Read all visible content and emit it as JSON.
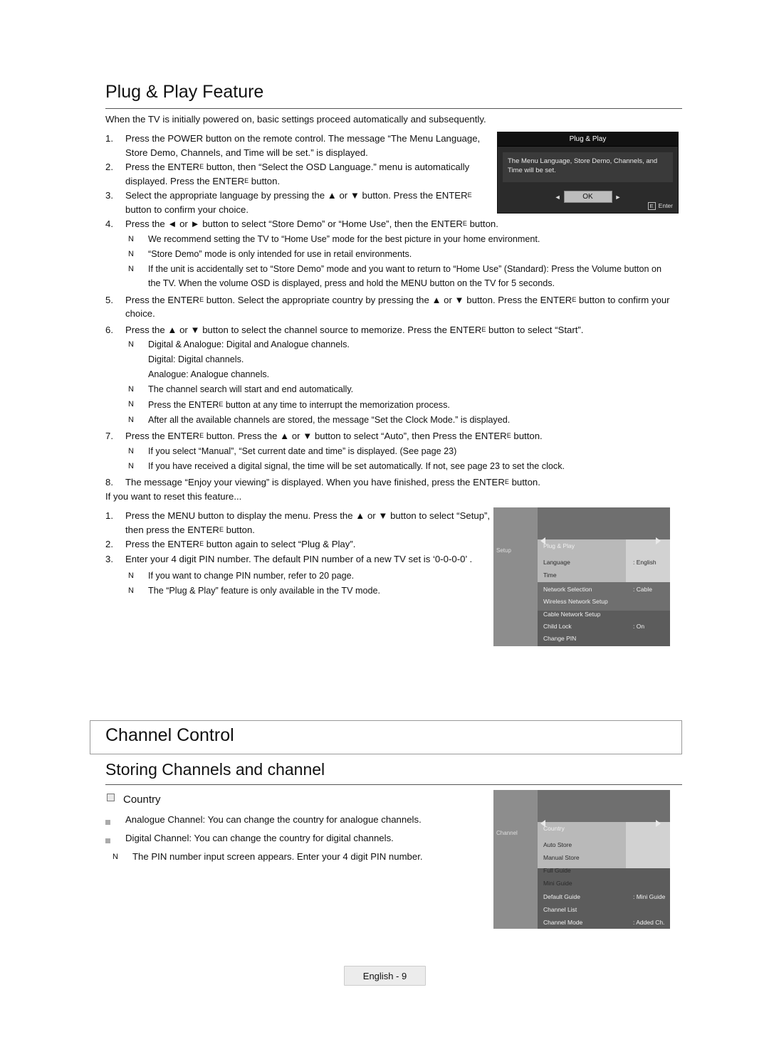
{
  "headings": {
    "plug_play": "Plug & Play Feature",
    "channel_control": "Channel Control",
    "storing": "Storing Channels and channel"
  },
  "intro": "When the TV is initially powered on, basic settings proceed automatically and subsequently.",
  "steps": [
    {
      "num": "1.",
      "text": "Press the POWER button on the remote control. The message “The Menu Language, Store Demo, Channels, and Time will be set.” is displayed.",
      "width": "narrow"
    },
    {
      "num": "2.",
      "text": "Press the ENTER",
      "tail": " button, then “Select the OSD Language.” menu is automatically displayed. Press the ENTER",
      "tail2": " button.",
      "width": "narrow",
      "enter": true
    },
    {
      "num": "3.",
      "text": "Select the appropriate language by pressing the ▲ or ▼ button. Press the ENTER",
      "tail": " button to confirm your choice.",
      "width": "narrow",
      "enter": true
    },
    {
      "num": "4.",
      "text": "Press the ◄ or ► button to select “Store Demo” or “Home Use”, then the ENTER",
      "tail": " button.",
      "width": "full",
      "enter": true
    }
  ],
  "notes_after_4": [
    "We recommend setting the TV to “Home Use” mode for the best picture in your home environment.",
    "“Store Demo” mode is only intended for use in retail environments.",
    "If the unit is accidentally set to “Store Demo” mode and you want to return to “Home Use” (Standard): Press the Volume button on the TV. When the volume OSD is displayed, press and hold the MENU button on the TV for 5 seconds."
  ],
  "step5": {
    "num": "5.",
    "a": "Press the ENTER",
    "b": " button. Select the appropriate country by pressing the ▲ or ▼ button. Press the ENTER",
    "c": " button to confirm your choice."
  },
  "step6": {
    "num": "6.",
    "a": "Press the ▲ or ▼ button to select the channel source to memorize. Press the ENTER",
    "b": " button to select “Start”."
  },
  "notes_after_6": [
    "Digital & Analogue: Digital and Analogue channels.",
    "Digital: Digital channels.",
    "Analogue: Analogue channels.",
    "The channel search will start and end automatically."
  ],
  "note_interrupt": {
    "a": "Press the ENTER",
    "b": " button at any time to interrupt the memorization process."
  },
  "note_stored": "After all the available channels are stored, the message “Set the Clock Mode.” is displayed.",
  "step7": {
    "num": "7.",
    "a": "Press the ENTER",
    "b": " button. Press the ▲ or ▼ button to select “Auto”, then Press the ENTER",
    "c": " button."
  },
  "notes_after_7": [
    "If you select “Manual”, “Set current date and time” is displayed. (See page 23)",
    "If you have received a digital signal, the time will be set automatically. If not, see page 23 to set the clock."
  ],
  "step8": {
    "num": "8.",
    "a": "The message “Enjoy your viewing” is displayed. When you have finished, press the ENTER",
    "b": " button."
  },
  "reset_lead": "If you want to reset this feature...",
  "reset_steps": [
    {
      "num": "1.",
      "text": "Press the MENU button to display the menu. Press the ▲ or ▼ button to select “Setup”, then press the ENTER",
      "tail": " button.",
      "enter": true
    },
    {
      "num": "2.",
      "text": "Press the ENTER",
      "tail": " button again to select “Plug & Play”.",
      "enter": true
    },
    {
      "num": "3.",
      "text": "Enter your 4 digit PIN number. The default PIN number of a new TV set is ‘0-0-0-0’ .",
      "enter": false
    }
  ],
  "reset_notes": [
    "If you want to change PIN number, refer to 20 page.",
    "The “Plug & Play” feature is only available in the TV mode."
  ],
  "country": {
    "title": "Country",
    "bullets": [
      "Analogue Channel: You can change the country for analogue channels.",
      "Digital Channel: You can change the country for digital channels."
    ],
    "note": "The PIN number input screen appears. Enter your 4 digit PIN number."
  },
  "osd_plug_play": {
    "title": "Plug & Play",
    "message": "The Menu Language, Store Demo, Channels, and Time will be set.",
    "ok_label": "OK",
    "arrow_left": "◄",
    "arrow_right": "►",
    "foot_key": "E",
    "foot_label": "Enter"
  },
  "menu_setup": {
    "side_label": "Setup",
    "items": [
      {
        "label": "Plug & Play",
        "value": "",
        "style": "light"
      },
      {
        "label": "Language",
        "value": ": English",
        "style": "dark"
      },
      {
        "label": "Time",
        "value": "",
        "style": "dark"
      },
      {
        "label": "Network Selection",
        "value": ": Cable",
        "style": "light"
      },
      {
        "label": "Wireless Network Setup",
        "value": "",
        "style": "light"
      },
      {
        "label": "Cable Network Setup",
        "value": "",
        "style": "light"
      },
      {
        "label": "Child Lock",
        "value": ": On",
        "style": "light"
      },
      {
        "label": "Change PIN",
        "value": "",
        "style": "light"
      }
    ]
  },
  "menu_channel": {
    "side_label": "Channel",
    "items": [
      {
        "label": "Country",
        "value": "",
        "style": "dark"
      },
      {
        "label": "Auto Store",
        "value": "",
        "style": "dark"
      },
      {
        "label": "Manual Store",
        "value": "",
        "style": "dark"
      },
      {
        "label": "Full Guide",
        "value": "",
        "style": "dark"
      },
      {
        "label": "Mini Guide",
        "value": "",
        "style": "dark"
      },
      {
        "label": "Default Guide",
        "value": ": Mini Guide",
        "style": "light"
      },
      {
        "label": "Channel List",
        "value": "",
        "style": "light"
      },
      {
        "label": "Channel Mode",
        "value": ": Added Ch.",
        "style": "light"
      }
    ]
  },
  "footer": {
    "page_label": "English - 9"
  }
}
